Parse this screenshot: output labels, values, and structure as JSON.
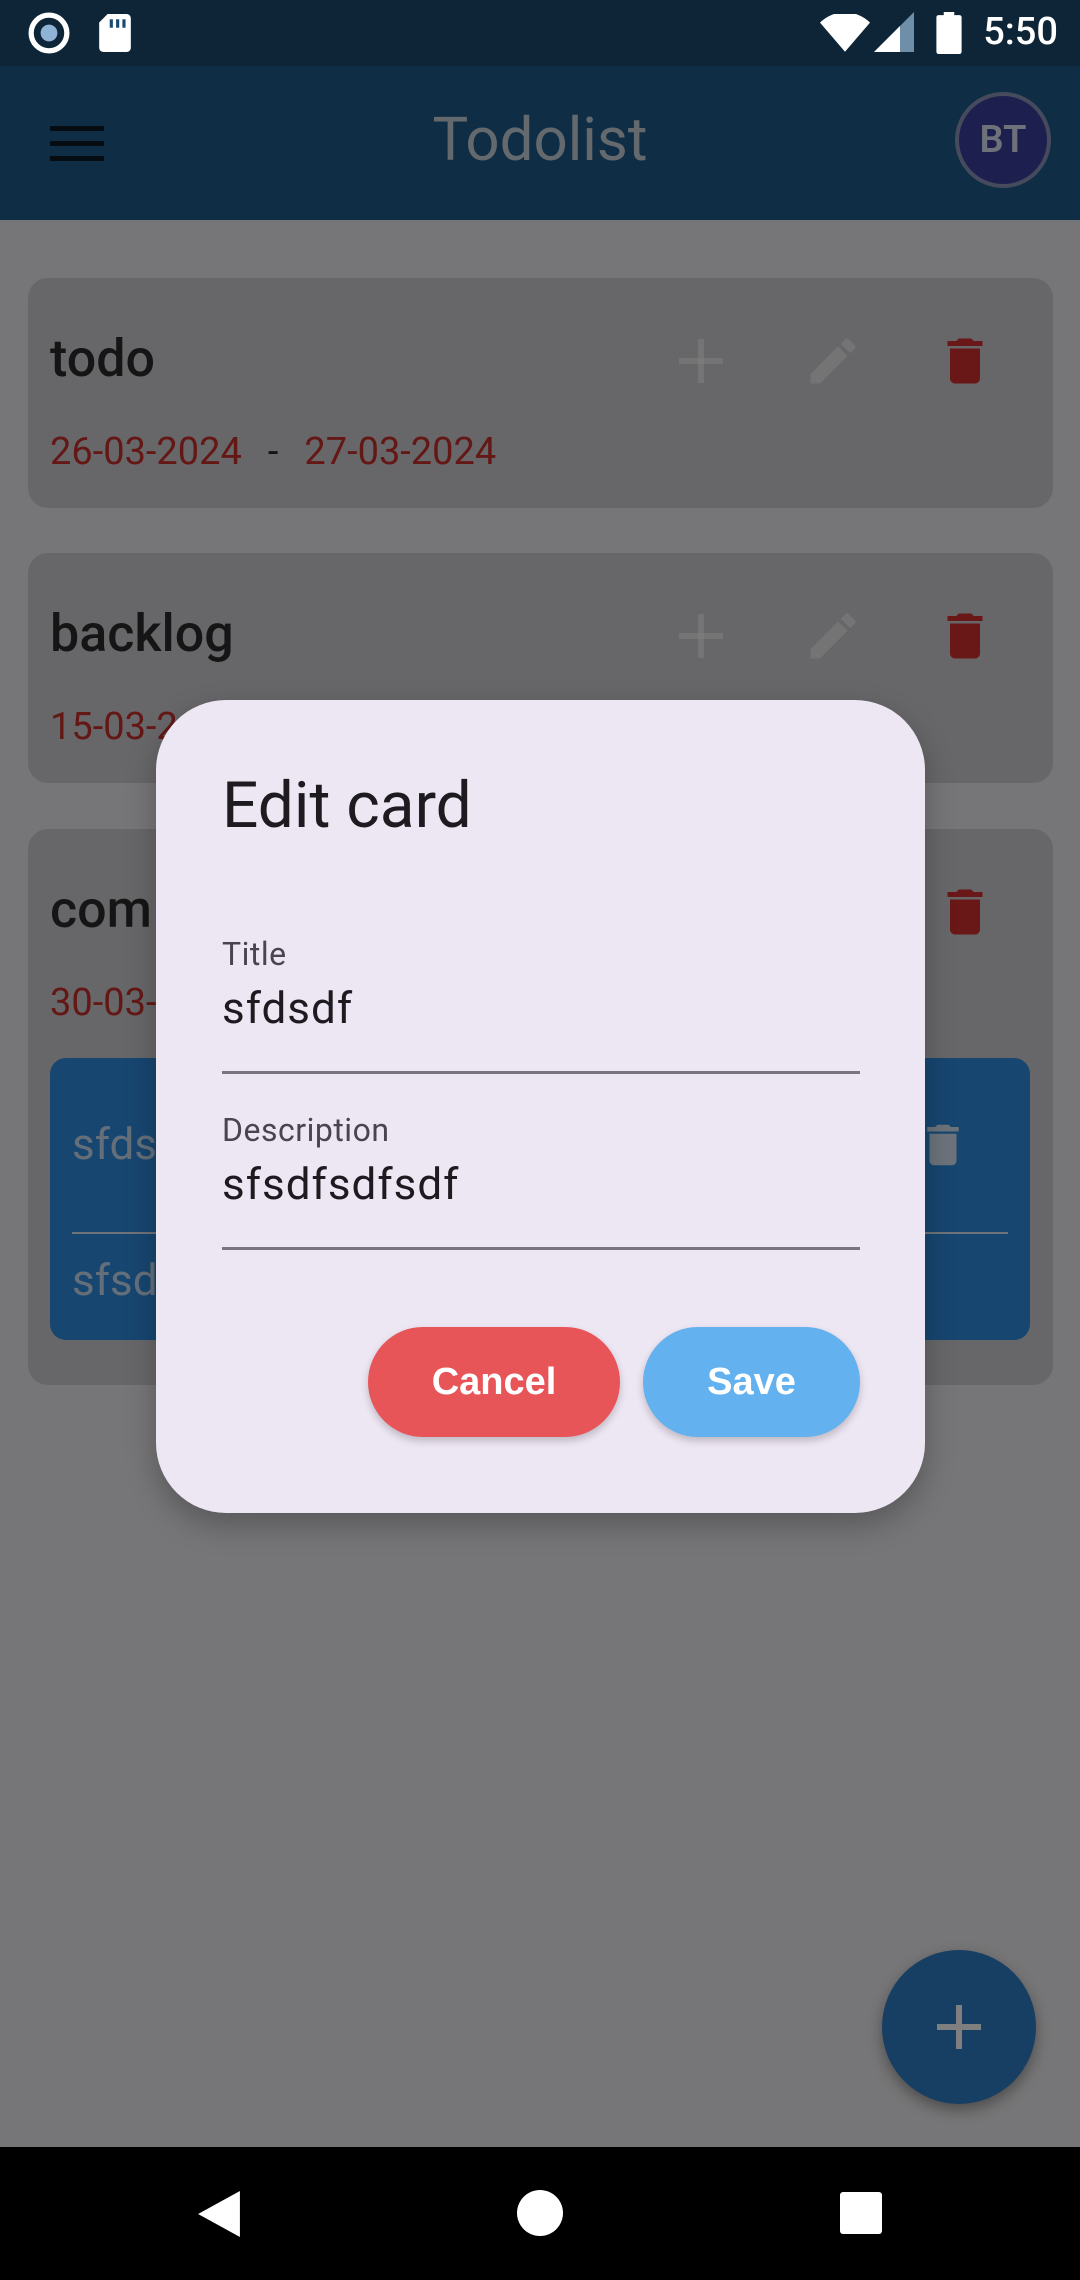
{
  "status_bar": {
    "time": "5:50"
  },
  "app_bar": {
    "title": "Todolist",
    "avatar_initials": "BT"
  },
  "lists": [
    {
      "title": "todo",
      "start_date": "26-03-2024",
      "end_date": "27-03-2024"
    },
    {
      "title": "backlog",
      "start_date": "15-03-2"
    },
    {
      "title": "com",
      "start_date": "30-03-"
    }
  ],
  "task_card": {
    "title": "sfds",
    "description": "sfsd"
  },
  "dialog": {
    "title": "Edit card",
    "title_field": {
      "label": "Title",
      "value": "sfdsdf"
    },
    "description_field": {
      "label": "Description",
      "value": "sfsdfsdfsdf"
    },
    "cancel_label": "Cancel",
    "save_label": "Save"
  },
  "colors": {
    "app_bar": "#1f5a88",
    "cancel": "#e85558",
    "save": "#64b1ef",
    "dialog_bg": "#ede6f3",
    "date": "#c8312c",
    "delete": "#d32f2f"
  },
  "icons": [
    "record-icon",
    "sd-card-icon",
    "wifi-icon",
    "signal-icon",
    "battery-icon",
    "menu-icon",
    "add-icon",
    "edit-icon",
    "delete-icon",
    "back-icon",
    "home-icon",
    "recents-icon"
  ]
}
